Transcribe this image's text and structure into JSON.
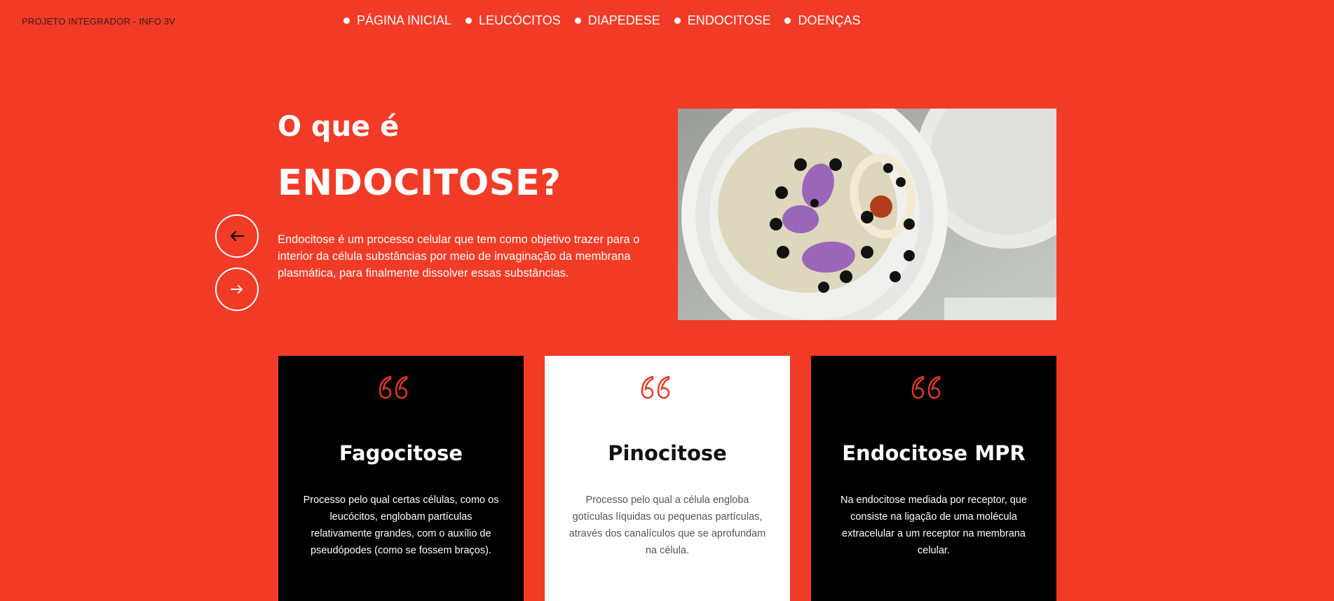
{
  "header": {
    "brand": "PROJETO INTEGRADOR - INFO 3V",
    "nav": [
      {
        "label": "PÁGINA INICIAL"
      },
      {
        "label": "LEUCÓCITOS"
      },
      {
        "label": "DIAPEDESE"
      },
      {
        "label": "ENDOCITOSE"
      },
      {
        "label": "DOENÇAS"
      }
    ]
  },
  "hero": {
    "title_small": "O que é",
    "title_big": "ENDOCITOSE?",
    "description": "Endocitose é um processo celular que tem como objetivo trazer para o interior da célula substâncias por meio de invaginação da membrana plasmática, para finalmente dissolver essas substâncias.",
    "prev_icon": "arrow-left-icon",
    "next_icon": "arrow-right-icon"
  },
  "cards": [
    {
      "title": "Fagocitose",
      "text": "Processo pelo qual certas células, como os leucócitos, englobam partículas relativamente grandes, com o auxílio de pseudópodes (como se fossem braços)."
    },
    {
      "title": "Pinocitose",
      "text": "Processo pelo qual a célula engloba gotículas líquidas ou pequenas partículas, através dos canalículos que se aprofundam na célula."
    },
    {
      "title": "Endocitose MPR",
      "text": "Na endocitose mediada por receptor, que consiste na ligação de uma molécula extracelular a um receptor na membrana celular."
    }
  ],
  "colors": {
    "background": "#f23b27",
    "card_dark": "#000000",
    "card_light": "#ffffff",
    "quote_accent": "#e0392b"
  }
}
